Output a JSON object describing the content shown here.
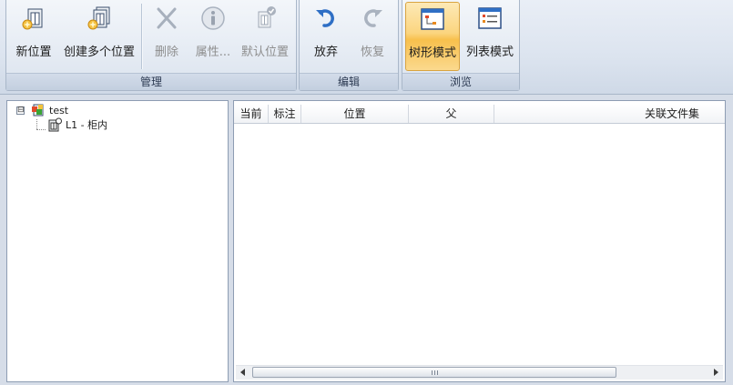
{
  "ribbon": {
    "groups": {
      "manage": {
        "label": "管理",
        "new_location": "新位置",
        "create_multiple": "创建多个位置",
        "delete": "删除",
        "properties": "属性...",
        "default_location": "默认位置"
      },
      "edit": {
        "label": "编辑",
        "discard": "放弃",
        "restore": "恢复"
      },
      "browse": {
        "label": "浏览",
        "tree_mode": "树形模式",
        "list_mode": "列表模式"
      }
    },
    "colors": {
      "active": "#fbd57f",
      "accent": "#2f6fc5"
    }
  },
  "tree": {
    "root": {
      "label": "test",
      "expander": "⊟"
    },
    "child": {
      "label": "L1 - 柜内"
    }
  },
  "grid": {
    "columns": [
      "当前",
      "标注",
      "位置",
      "父",
      "关联文件集"
    ],
    "rows": []
  }
}
